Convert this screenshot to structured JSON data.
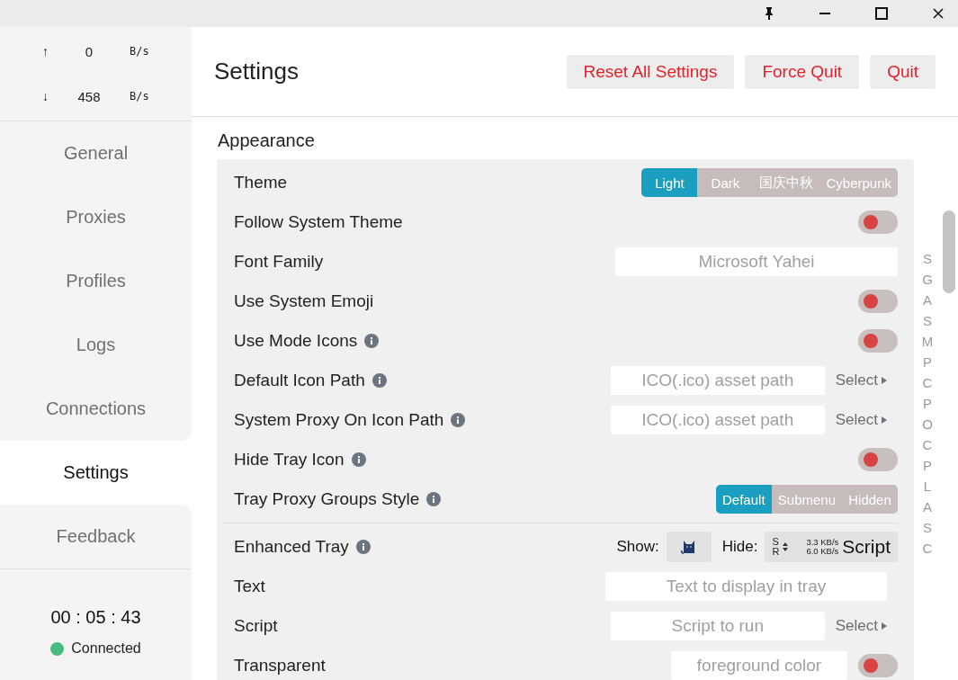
{
  "traffic": [
    {
      "arrow": "↑",
      "value": "0",
      "unit": "B/s"
    },
    {
      "arrow": "↓",
      "value": "458",
      "unit": "B/s"
    }
  ],
  "nav": [
    {
      "label": "General",
      "selected": false
    },
    {
      "label": "Proxies",
      "selected": false
    },
    {
      "label": "Profiles",
      "selected": false
    },
    {
      "label": "Logs",
      "selected": false
    },
    {
      "label": "Connections",
      "selected": false
    },
    {
      "label": "Settings",
      "selected": true
    },
    {
      "label": "Feedback",
      "selected": false
    }
  ],
  "timer": "00 : 05 : 43",
  "status": {
    "label": "Connected",
    "connected": true
  },
  "header": {
    "title": "Settings",
    "buttons": [
      "Reset All Settings",
      "Force Quit",
      "Quit"
    ]
  },
  "section": "Appearance",
  "rows": [
    {
      "kind": "segmented",
      "label": "Theme",
      "info": false,
      "options": [
        {
          "label": "Light",
          "selected": true
        },
        {
          "label": "Dark",
          "selected": false
        },
        {
          "label": "国庆中秋",
          "selected": false
        },
        {
          "label": "Cyberpunk",
          "selected": false
        }
      ]
    },
    {
      "kind": "toggle",
      "label": "Follow System Theme",
      "info": false,
      "on": false
    },
    {
      "kind": "input",
      "label": "Font Family",
      "info": false,
      "placeholder": "Microsoft Yahei"
    },
    {
      "kind": "toggle",
      "label": "Use System Emoji",
      "info": false,
      "on": false
    },
    {
      "kind": "toggle",
      "label": "Use Mode Icons",
      "info": true,
      "on": false
    },
    {
      "kind": "input-select",
      "label": "Default Icon Path",
      "info": true,
      "placeholder": "ICO(.ico) asset path",
      "select": "Select"
    },
    {
      "kind": "input-select",
      "label": "System Proxy On Icon Path",
      "info": true,
      "placeholder": "ICO(.ico) asset path",
      "select": "Select"
    },
    {
      "kind": "toggle",
      "label": "Hide Tray Icon",
      "info": true,
      "on": false
    },
    {
      "kind": "segmented",
      "label": "Tray Proxy Groups Style",
      "info": true,
      "options": [
        {
          "label": "Default",
          "selected": true
        },
        {
          "label": "Submenu",
          "selected": false
        },
        {
          "label": "Hidden",
          "selected": false
        }
      ]
    },
    {
      "kind": "tray",
      "label": "Enhanced Tray",
      "info": true,
      "divider": true,
      "show": "Show:",
      "hide": "Hide:",
      "mode_top": "S",
      "mode_bottom": "R",
      "up": "3.3 KB/s",
      "down": "6.0 KB/s",
      "text": "Script"
    },
    {
      "kind": "input",
      "label": "Text",
      "info": false,
      "placeholder": "Text to display in tray"
    },
    {
      "kind": "input-select",
      "label": "Script",
      "info": false,
      "placeholder": "Script to run",
      "select": "Select"
    },
    {
      "kind": "input-toggle",
      "label": "Transparent",
      "info": false,
      "placeholder": "foreground color",
      "on": false
    }
  ],
  "index": [
    "S",
    "G",
    "A",
    "S",
    "M",
    "P",
    "C",
    "P",
    "O",
    "C",
    "P",
    "L",
    "A",
    "S",
    "C"
  ]
}
